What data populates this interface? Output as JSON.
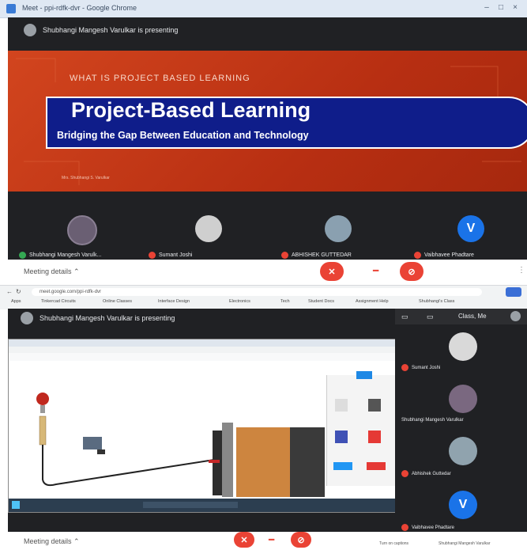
{
  "colors": {
    "meet_dark": "#202124",
    "slide_orange": "#c53a17",
    "banner_blue": "#0f1d8a",
    "hangup_red": "#ea4335",
    "avatar_blue": "#1a73e8"
  },
  "screenshot1": {
    "window_title": "Meet - ppi-rdfk-dvr - Google Chrome",
    "presenting_text": "Shubhangi Mangesh Varulkar is presenting",
    "slide": {
      "subtitle": "WHAT IS PROJECT BASED LEARNING",
      "title": "Project-Based Learning",
      "tagline": "Bridging the Gap Between Education and Technology",
      "author": "Mrs. Shubhangi S. Varulkar"
    },
    "participants": [
      {
        "name": "Shubhangi Mangesh Varulk...",
        "initial": ""
      },
      {
        "name": "Sumant Joshi",
        "initial": ""
      },
      {
        "name": "ABHISHEK GUTTEDAR",
        "initial": ""
      },
      {
        "name": "Vaibhavee Phadtare",
        "initial": "V"
      }
    ],
    "meeting_details": "Meeting details",
    "icons": [
      "mic-off-icon",
      "hangup-icon",
      "camera-off-icon"
    ]
  },
  "screenshot2": {
    "url": "meet.google.com/ppi-rdfk-dvr",
    "bookmarks": [
      "Apps",
      "Tinkercad Circuits",
      "Online Classes",
      "Interface Design",
      "Electronics",
      "Tech",
      "Student Docs",
      "Assignment Help",
      "Shubhangi's Class"
    ],
    "presenting_text": "Shubhangi Mangesh Varulkar is presenting",
    "side_header": "Class, Me",
    "side_participants": [
      {
        "name": "Sumant Joshi",
        "initial": ""
      },
      {
        "name": "Shubhangi Mangesh Varulkar",
        "initial": ""
      },
      {
        "name": "Abhishek Guttedar",
        "initial": ""
      },
      {
        "name": "Vaibhavee Phadtare",
        "initial": "V"
      }
    ],
    "meeting_details": "Meeting details",
    "bottom_right": [
      "Turn on captions",
      "Shubhangi Mangesh Varulkar"
    ]
  }
}
